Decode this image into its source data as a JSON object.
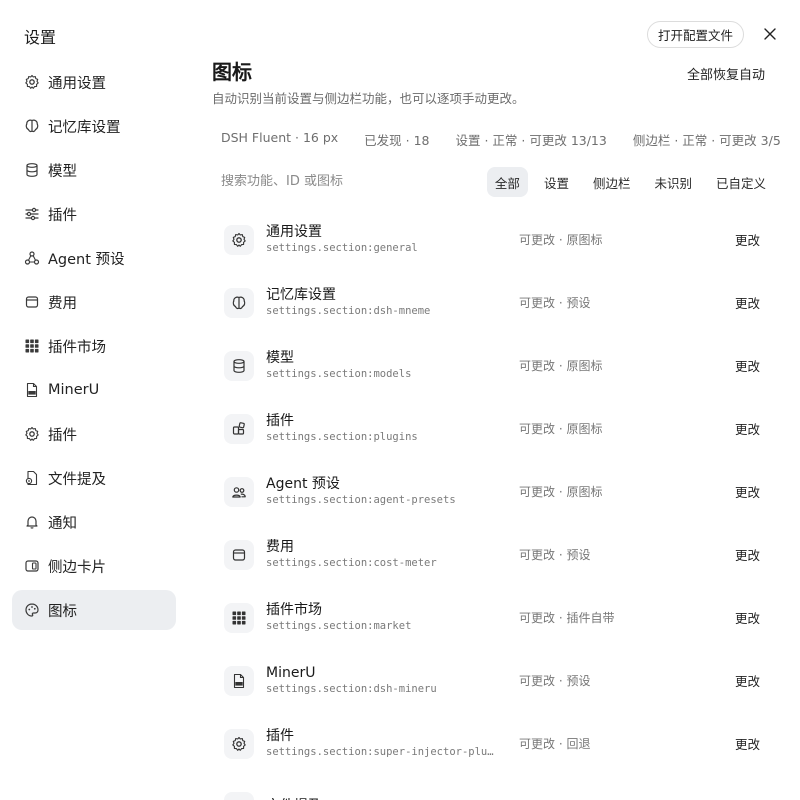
{
  "sidebar": {
    "title": "设置",
    "items": [
      {
        "label": "通用设置",
        "icon": "gear-icon"
      },
      {
        "label": "记忆库设置",
        "icon": "brain-icon"
      },
      {
        "label": "模型",
        "icon": "database-icon"
      },
      {
        "label": "插件",
        "icon": "sliders-icon"
      },
      {
        "label": "Agent 预设",
        "icon": "agent-icon"
      },
      {
        "label": "费用",
        "icon": "wallet-icon"
      },
      {
        "label": "插件市场",
        "icon": "grid-icon"
      },
      {
        "label": "MinerU",
        "icon": "pdf-file-icon"
      },
      {
        "label": "插件",
        "icon": "gear-icon"
      },
      {
        "label": "文件提及",
        "icon": "file-mention-icon"
      },
      {
        "label": "通知",
        "icon": "bell-icon"
      },
      {
        "label": "侧边卡片",
        "icon": "side-card-icon"
      },
      {
        "label": "图标",
        "icon": "palette-icon",
        "active": true
      }
    ]
  },
  "header": {
    "open_config_label": "打开配置文件",
    "title": "图标",
    "subtitle": "自动识别当前设置与侧边栏功能，也可以逐项手动更改。",
    "restore_all_label": "全部恢复自动"
  },
  "stats": {
    "theme": "DSH Fluent · 16 px",
    "found": "已发现 · 18",
    "settings": "设置 · 正常 · 可更改 13/13",
    "sidebar": "侧边栏 · 正常 · 可更改 3/5"
  },
  "search": {
    "placeholder": "搜索功能、ID 或图标"
  },
  "filters": [
    {
      "label": "全部",
      "active": true
    },
    {
      "label": "设置"
    },
    {
      "label": "侧边栏"
    },
    {
      "label": "未识别"
    },
    {
      "label": "已自定义"
    }
  ],
  "rows": [
    {
      "name": "通用设置",
      "id": "settings.section:general",
      "status": "可更改 · 原图标",
      "action": "更改",
      "icon": "gear-icon"
    },
    {
      "name": "记忆库设置",
      "id": "settings.section:dsh-mneme",
      "status": "可更改 · 预设",
      "action": "更改",
      "icon": "brain-icon"
    },
    {
      "name": "模型",
      "id": "settings.section:models",
      "status": "可更改 · 原图标",
      "action": "更改",
      "icon": "database-icon"
    },
    {
      "name": "插件",
      "id": "settings.section:plugins",
      "status": "可更改 · 原图标",
      "action": "更改",
      "icon": "puzzle-icon"
    },
    {
      "name": "Agent 预设",
      "id": "settings.section:agent-presets",
      "status": "可更改 · 原图标",
      "action": "更改",
      "icon": "users-icon"
    },
    {
      "name": "费用",
      "id": "settings.section:cost-meter",
      "status": "可更改 · 预设",
      "action": "更改",
      "icon": "wallet-icon"
    },
    {
      "name": "插件市场",
      "id": "settings.section:market",
      "status": "可更改 · 插件自带",
      "action": "更改",
      "icon": "grid-icon"
    },
    {
      "name": "MinerU",
      "id": "settings.section:dsh-mineru",
      "status": "可更改 · 预设",
      "action": "更改",
      "icon": "pdf-file-icon"
    },
    {
      "name": "插件",
      "id": "settings.section:super-injector-plu…",
      "status": "可更改 · 回退",
      "action": "更改",
      "icon": "gear-icon"
    },
    {
      "name": "文件提及",
      "id": "",
      "status": "",
      "action": "",
      "icon": "file-mention-icon"
    }
  ],
  "colors": {
    "accent_bg": "#eceef1",
    "icon_bg": "#f3f4f6",
    "muted_text": "#777777"
  }
}
